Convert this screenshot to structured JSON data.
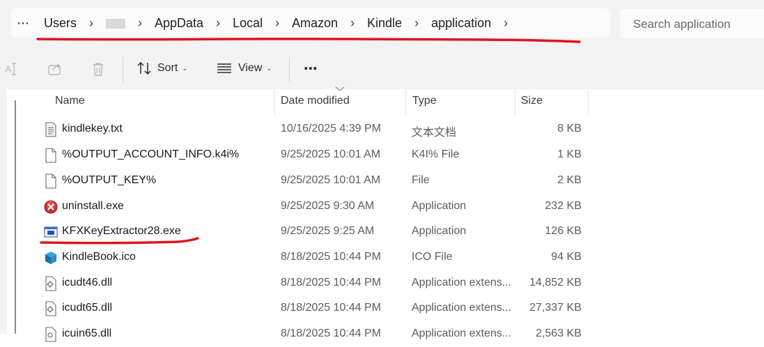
{
  "address_bar": {
    "more": "⋯",
    "crumbs": [
      "Users",
      "AppData",
      "Local",
      "Amazon",
      "Kindle",
      "application"
    ],
    "separator": "›"
  },
  "search": {
    "placeholder": "Search application"
  },
  "toolbar": {
    "sort_label": "Sort",
    "view_label": "View",
    "more": "⋯"
  },
  "columns": {
    "name": "Name",
    "date": "Date modified",
    "type": "Type",
    "size": "Size"
  },
  "files": [
    {
      "name": "kindlekey.txt",
      "date": "10/16/2025 4:39 PM",
      "type": "文本文档",
      "size": "8 KB",
      "icon": "text-file-icon"
    },
    {
      "name": "%OUTPUT_ACCOUNT_INFO.k4i%",
      "date": "9/25/2025 10:01 AM",
      "type": "K4I% File",
      "size": "1 KB",
      "icon": "blank-file-icon"
    },
    {
      "name": "%OUTPUT_KEY%",
      "date": "9/25/2025 10:01 AM",
      "type": "File",
      "size": "2 KB",
      "icon": "blank-file-icon"
    },
    {
      "name": "uninstall.exe",
      "date": "9/25/2025 9:30 AM",
      "type": "Application",
      "size": "232 KB",
      "icon": "uninstall-icon"
    },
    {
      "name": "KFXKeyExtractor28.exe",
      "date": "9/25/2025 9:25 AM",
      "type": "Application",
      "size": "126 KB",
      "icon": "application-icon"
    },
    {
      "name": "KindleBook.ico",
      "date": "8/18/2025 10:44 PM",
      "type": "ICO File",
      "size": "94 KB",
      "icon": "kindle-book-icon"
    },
    {
      "name": "icudt46.dll",
      "date": "8/18/2025 10:44 PM",
      "type": "Application extens...",
      "size": "14,852 KB",
      "icon": "dll-file-icon"
    },
    {
      "name": "icudt65.dll",
      "date": "8/18/2025 10:44 PM",
      "type": "Application extens...",
      "size": "27,337 KB",
      "icon": "dll-file-icon"
    },
    {
      "name": "icuin65.dll",
      "date": "8/18/2025 10:44 PM",
      "type": "Application extens...",
      "size": "2,563 KB",
      "icon": "dll-file-icon"
    }
  ],
  "colors": {
    "annotation_red": "#e0141e",
    "chrome_bg": "#f3f3f3"
  }
}
